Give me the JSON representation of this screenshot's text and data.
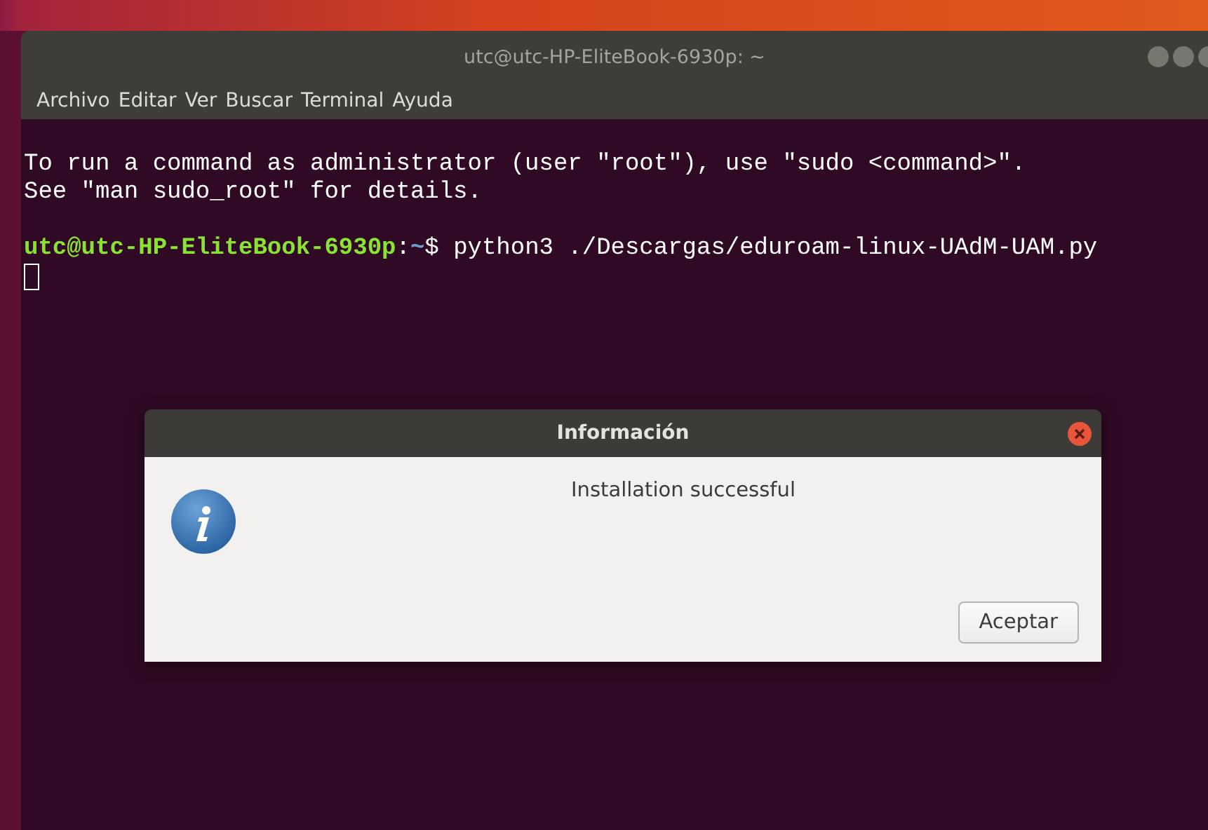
{
  "window": {
    "title": "utc@utc-HP-EliteBook-6930p: ~"
  },
  "menu": [
    "Archivo",
    "Editar",
    "Ver",
    "Buscar",
    "Terminal",
    "Ayuda"
  ],
  "terminal": {
    "lines": [
      {
        "kind": "text",
        "text": "To run a command as administrator (user \"root\"), use \"sudo <command>\"."
      },
      {
        "kind": "text",
        "text": "See \"man sudo_root\" for details."
      },
      {
        "kind": "blank"
      },
      {
        "kind": "prompt",
        "user_host": "utc@utc-HP-EliteBook-6930p",
        "separator": ":",
        "path": "~",
        "symbol": "$",
        "command": "python3 ./Descargas/eduroam-linux-UAdM-UAM.py"
      },
      {
        "kind": "cursor"
      }
    ]
  },
  "dialog": {
    "title": "Información",
    "message": "Installation successful",
    "button": "Aceptar"
  }
}
